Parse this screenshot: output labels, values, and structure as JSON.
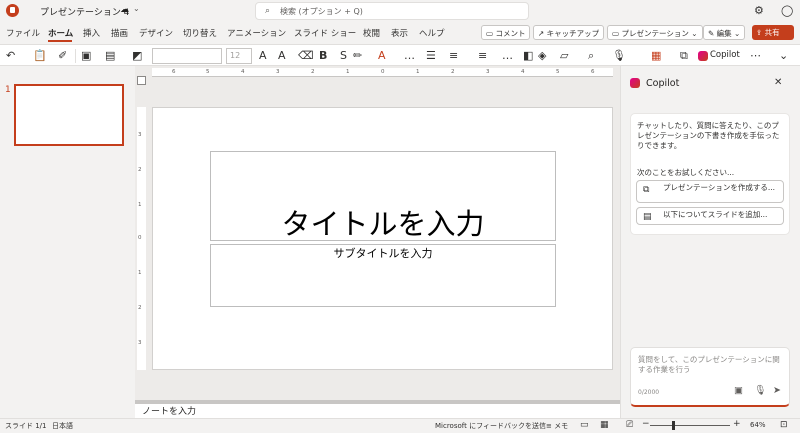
{
  "titlebar": {
    "doc_title": "プレゼンテーション 4",
    "search_placeholder": "検索 (オプション + Q)"
  },
  "menu": {
    "items": [
      "ファイル",
      "ホーム",
      "挿入",
      "描画",
      "デザイン",
      "切り替え",
      "アニメーション",
      "スライド ショー",
      "校閲",
      "表示",
      "ヘルプ"
    ],
    "active": "ホーム",
    "comment": "コメント",
    "catchup": "キャッチアップ",
    "present": "プレゼンテーション",
    "edit": "編集",
    "share": "共有"
  },
  "ribbon": {
    "font_size": "12",
    "copilot": "Copilot"
  },
  "thumbnails": {
    "slide_number": "1"
  },
  "ruler": {
    "h_ticks": [
      "6",
      "5",
      "4",
      "3",
      "2",
      "1",
      "0",
      "1",
      "2",
      "3",
      "4",
      "5",
      "6"
    ],
    "v_ticks": [
      "3",
      "2",
      "1",
      "0",
      "1",
      "2",
      "3"
    ]
  },
  "slide": {
    "title_placeholder": "タイトルを入力",
    "subtitle_placeholder": "サブタイトルを入力"
  },
  "notes": {
    "placeholder": "ノートを入力"
  },
  "copilot": {
    "title": "Copilot",
    "intro": "チャットしたり、質問に答えたり、このプレゼンテーションの下書き作成を手伝ったりできます。",
    "try_label": "次のことをお試しください...",
    "suggestions": [
      "プレゼンテーションを作成する...",
      "以下についてスライドを追加..."
    ],
    "input_placeholder": "質問をして、このプレゼンテーションに関する作業を行う",
    "char_count": "0/2000"
  },
  "status": {
    "slide_info": "スライド 1/1",
    "language": "日本語",
    "feedback": "Microsoft にフィードバックを送信",
    "notes_button": "メモ",
    "zoom": "64%",
    "zoom_level": 0.27
  },
  "colors": {
    "accent": "#c43e1c",
    "copilot_gradient": [
      "#e3008c",
      "#c43e1c"
    ]
  }
}
